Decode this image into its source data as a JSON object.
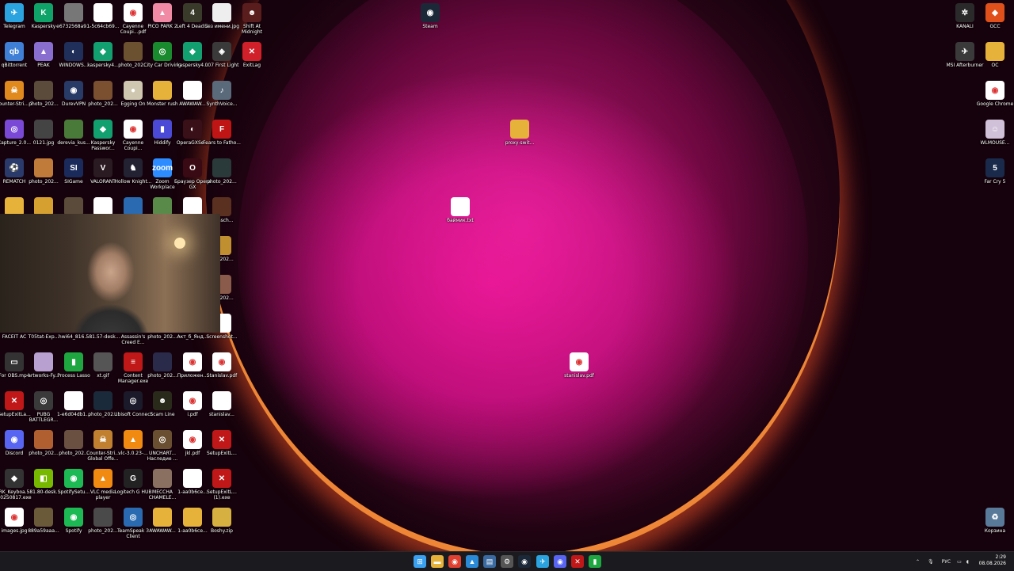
{
  "desktop": {
    "left_icons": [
      {
        "label": "Telegram",
        "color": "#2aa3df",
        "glyph": "✈",
        "icon": "telegram-icon"
      },
      {
        "label": "Kaspersky",
        "color": "#0fa36a",
        "glyph": "K",
        "icon": "kaspersky-icon"
      },
      {
        "label": "e6732568a9...",
        "color": "#777777",
        "glyph": "",
        "icon": "photo-icon"
      },
      {
        "label": "1-5c64cb69...",
        "color": "#ffffff",
        "glyph": "",
        "icon": "file-icon"
      },
      {
        "label": "Cayenne Coupi...pdf",
        "color": "#ffffff",
        "glyph": "◉",
        "icon": "chrome-pdf-icon"
      },
      {
        "label": "PICO PARK 2",
        "color": "#f08aa5",
        "glyph": "▲",
        "icon": "pico-park-icon"
      },
      {
        "label": "Left 4 Dead 2",
        "color": "#3a3a2a",
        "glyph": "4",
        "icon": "left4dead-icon"
      },
      {
        "label": "Без имени.jpg",
        "color": "#eeeeee",
        "glyph": "",
        "icon": "image-file-icon"
      },
      {
        "label": "Shift At Midnight",
        "color": "#5a1d1d",
        "glyph": "☻",
        "icon": "game-icon"
      },
      {
        "label": "qBittorrent",
        "color": "#3f7fd6",
        "glyph": "qb",
        "icon": "qbittorrent-icon"
      },
      {
        "label": "PEAK",
        "color": "#8a6ecf",
        "glyph": "▲",
        "icon": "peak-icon"
      },
      {
        "label": "WINDOWS...",
        "color": "#1f2f5a",
        "glyph": "◐",
        "icon": "windows-icon"
      },
      {
        "label": "kaspersky4...",
        "color": "#13a070",
        "glyph": "◆",
        "icon": "kaspersky-icon"
      },
      {
        "label": "photo_202...",
        "color": "#6b5130",
        "glyph": "",
        "icon": "photo-icon"
      },
      {
        "label": "City Car Driving",
        "color": "#1a8a2e",
        "glyph": "◎",
        "icon": "game-icon"
      },
      {
        "label": "kaspersky4...",
        "color": "#13a070",
        "glyph": "◆",
        "icon": "kaspersky-icon"
      },
      {
        "label": "007 First Light",
        "color": "#3a3a3a",
        "glyph": "◈",
        "icon": "game-icon"
      },
      {
        "label": "ExitLag",
        "color": "#d0202a",
        "glyph": "✕",
        "icon": "exitlag-icon"
      },
      {
        "label": "Counter-Stri... 2",
        "color": "#e08a1e",
        "glyph": "☠",
        "icon": "cs2-icon"
      },
      {
        "label": "photo_202...",
        "color": "#5a4b3a",
        "glyph": "",
        "icon": "photo-icon"
      },
      {
        "label": "DurevVPN",
        "color": "#283a66",
        "glyph": "◉",
        "icon": "vpn-icon"
      },
      {
        "label": "photo_202...",
        "color": "#7a5030",
        "glyph": "",
        "icon": "photo-icon"
      },
      {
        "label": "Egging On",
        "color": "#cfc7b0",
        "glyph": "●",
        "icon": "game-icon"
      },
      {
        "label": "Monster rush",
        "color": "#e6b23a",
        "glyph": "",
        "icon": "folder-icon"
      },
      {
        "label": "AWAWAW...",
        "color": "#ffffff",
        "glyph": "",
        "icon": "file-icon"
      },
      {
        "label": "SynthVoice...",
        "color": "#5a6a7a",
        "glyph": "♪",
        "icon": "app-icon"
      },
      {
        "label": "Capture_2.0...",
        "color": "#7a4ad6",
        "glyph": "◎",
        "icon": "capture-icon"
      },
      {
        "label": "0121.jpg",
        "color": "#444444",
        "glyph": "",
        "icon": "image-file-icon"
      },
      {
        "label": "derevia_kus...",
        "color": "#4a7a3a",
        "glyph": "",
        "icon": "image-file-icon"
      },
      {
        "label": "Kaspersky Passwor...",
        "color": "#13a070",
        "glyph": "◆",
        "icon": "kaspersky-icon"
      },
      {
        "label": "Cayenne Coupi...",
        "color": "#ffffff",
        "glyph": "◉",
        "icon": "chrome-pdf-icon"
      },
      {
        "label": "Hiddify",
        "color": "#4a4ad6",
        "glyph": "▮",
        "icon": "hiddify-icon"
      },
      {
        "label": "OperaGXSe...",
        "color": "#3a1018",
        "glyph": "◐",
        "icon": "opera-gx-icon"
      },
      {
        "label": "Fears to Fatho...",
        "color": "#c01515",
        "glyph": "F",
        "icon": "game-icon"
      },
      {
        "label": "REMATCH",
        "color": "#2a3a6a",
        "glyph": "⚽",
        "icon": "game-icon"
      },
      {
        "label": "photo_202...",
        "color": "#c07a3a",
        "glyph": "",
        "icon": "photo-icon"
      },
      {
        "label": "SIGame",
        "color": "#1a2a5a",
        "glyph": "SI",
        "icon": "sigame-icon"
      },
      {
        "label": "VALORANT",
        "color": "#2a1a22",
        "glyph": "V",
        "icon": "valorant-icon"
      },
      {
        "label": "Hollow Knight...",
        "color": "#222233",
        "glyph": "♞",
        "icon": "game-icon"
      },
      {
        "label": "Zoom Workplace",
        "color": "#2d8cff",
        "glyph": "zoom",
        "icon": "zoom-icon"
      },
      {
        "label": "Браузер Opera GX",
        "color": "#3a0a14",
        "glyph": "O",
        "icon": "opera-gx-icon"
      },
      {
        "label": "photo_202...",
        "color": "#2a3a3a",
        "glyph": "",
        "icon": "photo-icon"
      },
      {
        "label": "",
        "color": "#e6b23a",
        "glyph": "",
        "icon": "folder-icon"
      },
      {
        "label": "",
        "color": "#d6a030",
        "glyph": "",
        "icon": "image-file-icon"
      },
      {
        "label": "",
        "color": "#5a4b3a",
        "glyph": "",
        "icon": "photo-icon"
      },
      {
        "label": "",
        "color": "#ffffff",
        "glyph": "",
        "icon": "file-icon"
      },
      {
        "label": "",
        "color": "#2a6ab0",
        "glyph": "",
        "icon": "app-icon"
      },
      {
        "label": "",
        "color": "#5a8a4a",
        "glyph": "",
        "icon": "photo-icon"
      },
      {
        "label": "",
        "color": "#ffffff",
        "glyph": "",
        "icon": "file-icon"
      },
      {
        "label": "...onsch...",
        "color": "#5a3020",
        "glyph": "",
        "icon": "video-file-icon"
      },
      {
        "label": "...o_202...",
        "color": "#c09030",
        "glyph": "",
        "icon": "photo-icon"
      },
      {
        "label": "...o_202...",
        "color": "#8a5a4a",
        "glyph": "",
        "icon": "photo-icon"
      },
      {
        "label": "FACEIT AC",
        "color": "#333333",
        "glyph": "",
        "icon": "faceit-icon"
      },
      {
        "label": "T05tat-Exp...",
        "color": "#333333",
        "glyph": "",
        "icon": "file-icon"
      },
      {
        "label": "hwi64_816...",
        "color": "#333333",
        "glyph": "",
        "icon": "app-icon"
      },
      {
        "label": "581.57-desk...",
        "color": "#333333",
        "glyph": "",
        "icon": "app-icon"
      },
      {
        "label": "Assassin's Creed E...",
        "color": "#333333",
        "glyph": "",
        "icon": "game-icon"
      },
      {
        "label": "photo_202...",
        "color": "#333333",
        "glyph": "",
        "icon": "photo-icon"
      },
      {
        "label": "Акт_б_Янд...",
        "color": "#333333",
        "glyph": "",
        "icon": "file-icon"
      },
      {
        "label": "Screenshot...",
        "color": "#ffffff",
        "glyph": "",
        "icon": "image-file-icon"
      },
      {
        "label": "For OBS.mp4",
        "color": "#333333",
        "glyph": "▭",
        "icon": "video-file-icon"
      },
      {
        "label": "artworks-Fy...",
        "color": "#b8a0d0",
        "glyph": "",
        "icon": "image-file-icon"
      },
      {
        "label": "Process Lasso",
        "color": "#1ea640",
        "glyph": "▮",
        "icon": "process-lasso-icon"
      },
      {
        "label": "xt.gif",
        "color": "#555555",
        "glyph": "",
        "icon": "image-file-icon"
      },
      {
        "label": "Content Manager.exe",
        "color": "#c01818",
        "glyph": "≡",
        "icon": "app-icon"
      },
      {
        "label": "photo_202...",
        "color": "#2a2a4a",
        "glyph": "",
        "icon": "photo-icon"
      },
      {
        "label": "Приложен...",
        "color": "#ffffff",
        "glyph": "◉",
        "icon": "chrome-pdf-icon"
      },
      {
        "label": "Stanislav.pdf",
        "color": "#ffffff",
        "glyph": "◉",
        "icon": "chrome-pdf-icon"
      },
      {
        "label": "SetupExitLa...",
        "color": "#c01818",
        "glyph": "✕",
        "icon": "exitlag-icon"
      },
      {
        "label": "PUBG BATTLEGR...",
        "color": "#3a3a3a",
        "glyph": "◎",
        "icon": "game-icon"
      },
      {
        "label": "1-e6d04db1...",
        "color": "#ffffff",
        "glyph": "",
        "icon": "file-icon"
      },
      {
        "label": "photo_202...",
        "color": "#1a2a3a",
        "glyph": "",
        "icon": "photo-icon"
      },
      {
        "label": "Ubisoft Connect",
        "color": "#1a1a2a",
        "glyph": "◎",
        "icon": "ubisoft-icon"
      },
      {
        "label": "Scam Line",
        "color": "#2a2a1a",
        "glyph": "☻",
        "icon": "game-icon"
      },
      {
        "label": "i.pdf",
        "color": "#ffffff",
        "glyph": "◉",
        "icon": "chrome-pdf-icon"
      },
      {
        "label": "stanislav...",
        "color": "#ffffff",
        "glyph": "",
        "icon": "file-icon"
      },
      {
        "label": "Discord",
        "color": "#5865f2",
        "glyph": "◉",
        "icon": "discord-icon"
      },
      {
        "label": "photo_202...",
        "color": "#b06030",
        "glyph": "",
        "icon": "photo-icon"
      },
      {
        "label": "photo_202...",
        "color": "#6a5040",
        "glyph": "",
        "icon": "photo-icon"
      },
      {
        "label": "Counter-Stri... Global Offe...",
        "color": "#c08030",
        "glyph": "☠",
        "icon": "csgo-icon"
      },
      {
        "label": "vlc-3.0.23-...",
        "color": "#f08a10",
        "glyph": "▲",
        "icon": "vlc-icon"
      },
      {
        "label": "UNCHART... Наследие ...",
        "color": "#6a5030",
        "glyph": "◎",
        "icon": "game-icon"
      },
      {
        "label": "jkl.pdf",
        "color": "#ffffff",
        "glyph": "◉",
        "icon": "chrome-pdf-icon"
      },
      {
        "label": "SetupExitL...",
        "color": "#c01818",
        "glyph": "✕",
        "icon": "exitlag-icon"
      },
      {
        "label": "RK_Keyboa... 20250817.exe",
        "color": "#333333",
        "glyph": "◆",
        "icon": "app-icon"
      },
      {
        "label": "581.80-desk...",
        "color": "#76b900",
        "glyph": "◧",
        "icon": "nvidia-icon"
      },
      {
        "label": "SpotifySetu...",
        "color": "#1db954",
        "glyph": "◉",
        "icon": "spotify-icon"
      },
      {
        "label": "VLC media player",
        "color": "#f08a10",
        "glyph": "▲",
        "icon": "vlc-icon"
      },
      {
        "label": "Logitech G HUB",
        "color": "#222222",
        "glyph": "G",
        "icon": "logitech-icon"
      },
      {
        "label": "MECCHA CHAMELE...",
        "color": "#8a7060",
        "glyph": "",
        "icon": "game-icon"
      },
      {
        "label": "1-aa0b6ce...",
        "color": "#ffffff",
        "glyph": "",
        "icon": "file-icon"
      },
      {
        "label": "SetupExitL... (1).exe",
        "color": "#c01818",
        "glyph": "✕",
        "icon": "exitlag-icon"
      },
      {
        "label": "images.jpg",
        "color": "#ffffff",
        "glyph": "◉",
        "icon": "image-file-icon"
      },
      {
        "label": "889a59aaa...",
        "color": "#6a5a3a",
        "glyph": "",
        "icon": "image-file-icon"
      },
      {
        "label": "Spotify",
        "color": "#1db954",
        "glyph": "◉",
        "icon": "spotify-icon"
      },
      {
        "label": "photo_202...",
        "color": "#4a4a4a",
        "glyph": "",
        "icon": "photo-icon"
      },
      {
        "label": "TeamSpeak 3 Client",
        "color": "#2a6ab0",
        "glyph": "◎",
        "icon": "teamspeak-icon"
      },
      {
        "label": "AWAWAW...",
        "color": "#e6b23a",
        "glyph": "",
        "icon": "folder-icon"
      },
      {
        "label": "1-aa0b6ce...",
        "color": "#e6b23a",
        "glyph": "",
        "icon": "folder-icon"
      },
      {
        "label": "Boshy.zip",
        "color": "#d6b040",
        "glyph": "",
        "icon": "zip-icon"
      }
    ],
    "center_icons": [
      {
        "label": "Steam",
        "color": "#1b2838",
        "glyph": "◉",
        "icon": "steam-icon"
      },
      {
        "label": "proxy-swit...",
        "color": "#e6b23a",
        "glyph": "",
        "icon": "folder-icon"
      },
      {
        "label": "баймик.txt",
        "color": "#ffffff",
        "glyph": "",
        "icon": "text-file-icon"
      },
      {
        "label": "stanislav.pdf",
        "color": "#ffffff",
        "glyph": "◉",
        "icon": "chrome-pdf-icon"
      }
    ],
    "right_icons": [
      {
        "label": "KANALI",
        "color": "#2a2a2a",
        "glyph": "✲",
        "icon": "app-icon"
      },
      {
        "label": "GCC",
        "color": "#e0501a",
        "glyph": "◆",
        "icon": "gcc-icon"
      },
      {
        "label": "MSI Afterburner",
        "color": "#3a3a3a",
        "glyph": "✈",
        "icon": "msi-afterburner-icon"
      },
      {
        "label": "OC",
        "color": "#e6b23a",
        "glyph": "",
        "icon": "folder-icon"
      },
      {
        "label": "Google Chrome",
        "color": "#ffffff",
        "glyph": "◉",
        "icon": "chrome-icon"
      },
      {
        "label": "WLMOUSE...",
        "color": "#d0c0d8",
        "glyph": "☺",
        "icon": "app-icon"
      },
      {
        "label": "Far Cry 5",
        "color": "#1a2a4a",
        "glyph": "5",
        "icon": "farcry5-icon"
      },
      {
        "label": "Корзина",
        "color": "#5a7a9a",
        "glyph": "♻",
        "icon": "recycle-bin-icon"
      }
    ]
  },
  "taskbar": {
    "apps": [
      {
        "name": "start-button-icon",
        "color": "#3aa0f0",
        "glyph": "⊞"
      },
      {
        "name": "file-explorer-icon",
        "color": "#e6b23a",
        "glyph": "▬"
      },
      {
        "name": "chrome-icon",
        "color": "#e04030",
        "glyph": "◉"
      },
      {
        "name": "photos-icon",
        "color": "#2a8ad6",
        "glyph": "▲"
      },
      {
        "name": "notepad-icon",
        "color": "#3a6aa0",
        "glyph": "▤"
      },
      {
        "name": "app-icon",
        "color": "#555555",
        "glyph": "⚙"
      },
      {
        "name": "steam-icon",
        "color": "#1b2838",
        "glyph": "◉"
      },
      {
        "name": "telegram-icon",
        "color": "#2aa3df",
        "glyph": "✈"
      },
      {
        "name": "discord-icon",
        "color": "#5865f2",
        "glyph": "◉"
      },
      {
        "name": "exitlag-icon",
        "color": "#c01818",
        "glyph": "✕"
      },
      {
        "name": "process-lasso-icon",
        "color": "#1ea640",
        "glyph": "▮"
      }
    ],
    "tray": {
      "language": "РУС",
      "time": "2:29",
      "date": "08.08.2026"
    }
  }
}
